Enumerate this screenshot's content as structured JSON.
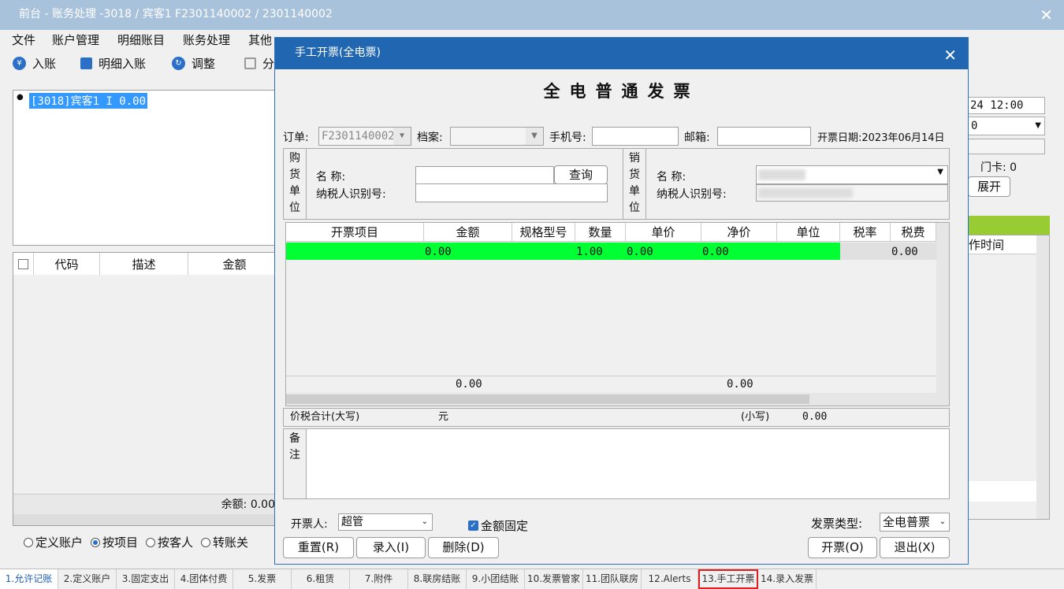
{
  "window": {
    "title": "前台 - 账务处理 -3018 / 宾客1  F2301140002 / 2301140002"
  },
  "menu": [
    "文件",
    "账户管理",
    "明细账目",
    "账务处理",
    "其他"
  ],
  "toolbar": {
    "post": "入账",
    "detail_post": "明细入账",
    "adjust": "调整",
    "split": "分"
  },
  "tree": {
    "item": "[3018]宾客1          I        0.00"
  },
  "grid": {
    "headers": [
      "代码",
      "描述",
      "金额"
    ],
    "balance": "余额: 0.00"
  },
  "radios": {
    "items": [
      "定义账户",
      "按项目",
      "按客人",
      "转账关"
    ],
    "selected": 1
  },
  "right_panel": {
    "time": "24 12:00",
    "select_val": "0",
    "card": "门卡: 0",
    "expand": "展开",
    "op_time": "作时间"
  },
  "tabs": [
    "1.允许记账",
    "2.定义账户",
    "3.固定支出",
    "4.团体付费",
    "5.发票",
    "6.租赁",
    "7.附件",
    "8.联房结账",
    "9.小团结账",
    "10.发票管家",
    "11.团队联房",
    "12.Alerts",
    "13.手工开票",
    "14.录入发票"
  ],
  "dialog": {
    "title": "手工开票(全电票)",
    "invoice_title": "全电普通发票",
    "order_label": "订单:",
    "order_value": "F2301140002",
    "file_label": "档案:",
    "phone_label": "手机号:",
    "email_label": "邮箱:",
    "date_label": "开票日期:",
    "date_value": "2023年06月14日",
    "buyer_label": "购货单位",
    "seller_label": "销货单位",
    "name_label": "名      称:",
    "taxid_label": "纳税人识别号:",
    "query_btn": "查询",
    "grid_headers": [
      "开票项目",
      "金额",
      "规格型号",
      "数量",
      "单价",
      "净价",
      "单位",
      "税率",
      "税费"
    ],
    "row": {
      "amount": "0.00",
      "qty": "1.00",
      "price": "0.00",
      "net": "0.00",
      "tax": "0.00"
    },
    "totals": {
      "amount": "0.00",
      "net": "0.00"
    },
    "sum_label": "价税合计(大写)",
    "yuan": "元",
    "small_label": "(小写)",
    "small_value": "0.00",
    "remark_label": "备注",
    "issuer_label": "开票人:",
    "issuer_value": "超管",
    "fixed_label": "金额固定",
    "type_label": "发票类型:",
    "type_value": "全电普票",
    "buttons": {
      "reset": "重置(R)",
      "enter": "录入(I)",
      "delete": "删除(D)",
      "issue": "开票(O)",
      "exit": "退出(X)"
    }
  }
}
